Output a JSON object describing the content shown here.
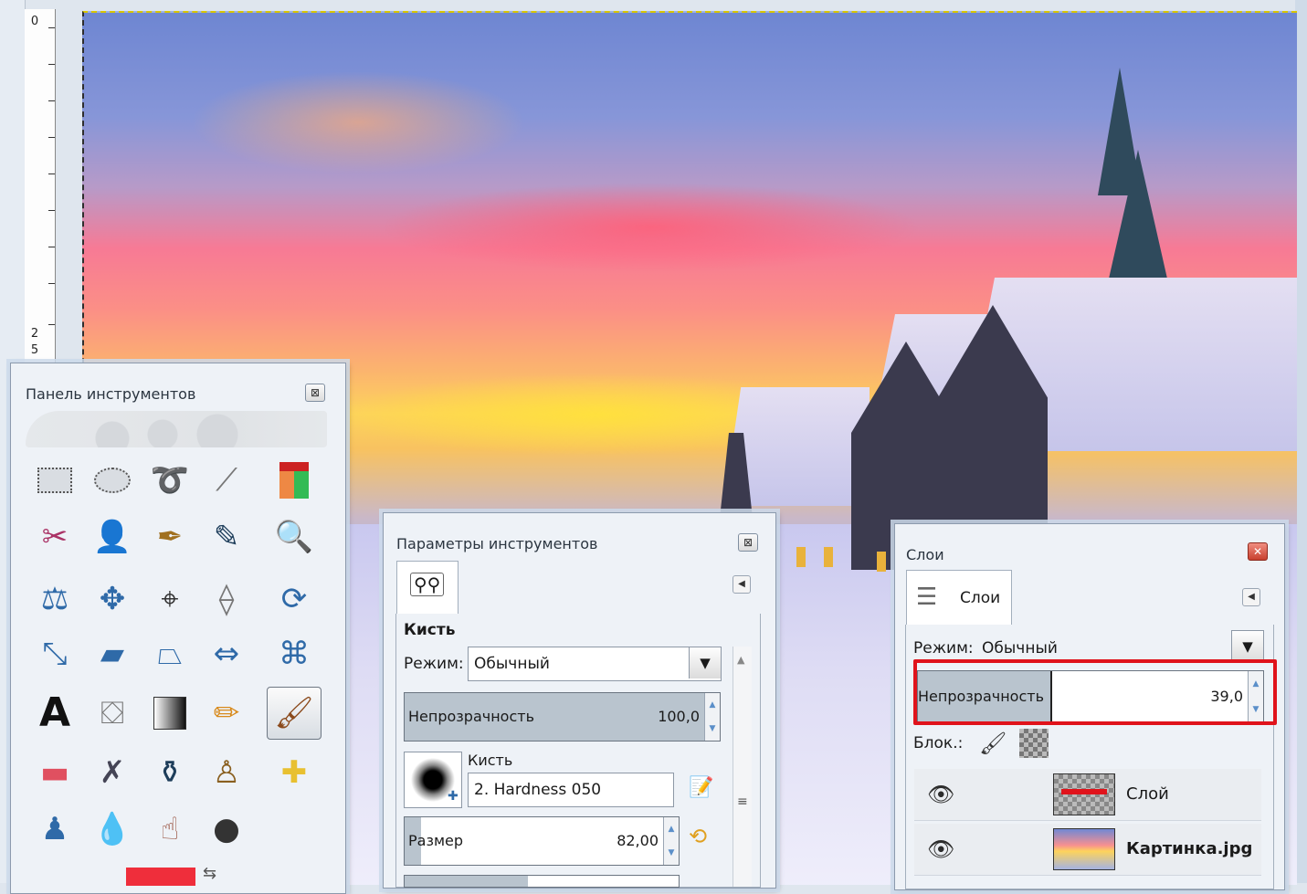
{
  "ruler": {
    "marks": [
      "0",
      "2",
      "5"
    ]
  },
  "toolbox": {
    "title": "Панель инструментов",
    "close_label": "⊠",
    "fg_color": "#ef2e3b",
    "tools": [
      "rect-select",
      "ellipse-select",
      "free-select",
      "fuzzy-select",
      "color-select",
      "scissors-select",
      "foreground-select",
      "paths",
      "color-picker",
      "zoom",
      "measure",
      "move",
      "alignment",
      "crop",
      "rotate",
      "scale",
      "shear",
      "perspective",
      "flip",
      "cage-transform",
      "text",
      "bucket-fill",
      "blend",
      "pencil",
      "paintbrush",
      "eraser",
      "airbrush",
      "ink",
      "clone",
      "heal",
      "perspective-clone",
      "blur",
      "smudge",
      "dodge-burn"
    ]
  },
  "tool_options": {
    "title": "Параметры инструментов",
    "close_label": "⊠",
    "section": "Кисть",
    "mode_label": "Режим:",
    "mode_value": "Обычный",
    "opacity_label": "Непрозрачность",
    "opacity_value": "100,0",
    "opacity_fraction": 1.0,
    "brush_label": "Кисть",
    "brush_value": "2. Hardness 050",
    "size_label": "Размер",
    "size_value": "82,00"
  },
  "layers": {
    "title": "Слои",
    "tab_label": "Слои",
    "mode_label": "Режим:",
    "mode_value": "Обычный",
    "opacity_label": "Непрозрачность",
    "opacity_value": "39,0",
    "opacity_fraction": 0.39,
    "lock_label": "Блок.:",
    "items": [
      {
        "name": "Слой",
        "bold": false
      },
      {
        "name": "Картинка.jpg",
        "bold": true
      }
    ]
  },
  "colors": {
    "highlight": "#e0131b",
    "accent": "#5b8fc9"
  }
}
